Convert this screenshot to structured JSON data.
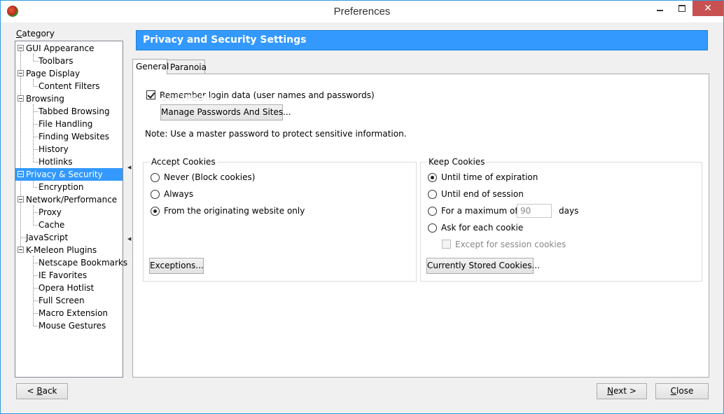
{
  "window": {
    "title": "Preferences",
    "minimize_symbol": "—",
    "maximize_symbol": "□",
    "close_symbol": "✕"
  },
  "sidebar": {
    "label": "Category",
    "items": [
      {
        "label": "GUI Appearance",
        "level": 0
      },
      {
        "label": "Toolbars",
        "level": 1
      },
      {
        "label": "Page Display",
        "level": 0
      },
      {
        "label": "Content Filters",
        "level": 1
      },
      {
        "label": "Browsing",
        "level": 0
      },
      {
        "label": "Tabbed Browsing",
        "level": 1
      },
      {
        "label": "File Handling",
        "level": 1
      },
      {
        "label": "Finding Websites",
        "level": 1
      },
      {
        "label": "History",
        "level": 1
      },
      {
        "label": "Hotlinks",
        "level": 1
      },
      {
        "label": "Privacy & Security",
        "level": 0,
        "selected": true
      },
      {
        "label": "Encryption",
        "level": 1
      },
      {
        "label": "Network/Performance",
        "level": 0
      },
      {
        "label": "Proxy",
        "level": 1
      },
      {
        "label": "Cache",
        "level": 1
      },
      {
        "label": "JavaScript",
        "level": 0
      },
      {
        "label": "K-Meleon Plugins",
        "level": 0
      },
      {
        "label": "Netscape Bookmarks",
        "level": 1
      },
      {
        "label": "IE Favorites",
        "level": 1
      },
      {
        "label": "Opera Hotlist",
        "level": 1
      },
      {
        "label": "Full Screen",
        "level": 1
      },
      {
        "label": "Macro Extension",
        "level": 1
      },
      {
        "label": "Mouse Gestures",
        "level": 1
      }
    ]
  },
  "main": {
    "header": "Privacy and Security Settings",
    "tabs": [
      {
        "label": "General",
        "active": true
      },
      {
        "label": "Paranoia",
        "active": false
      }
    ],
    "watermark": "SOFTPEDIA",
    "remember_login": {
      "label": "Remember login data (user names and passwords)",
      "checked": true
    },
    "manage_passwords_label": "Manage Passwords And Sites...",
    "note": "Note: Use a master password to protect sensitive information.",
    "accept_cookies": {
      "title": "Accept Cookies",
      "options": [
        {
          "label": "Never (Block cookies)",
          "selected": false
        },
        {
          "label": "Always",
          "selected": false
        },
        {
          "label": "From the originating website only",
          "selected": true
        }
      ],
      "exceptions_label": "Exceptions..."
    },
    "keep_cookies": {
      "title": "Keep Cookies",
      "options": [
        {
          "label": "Until time of expiration",
          "selected": true
        },
        {
          "label": "Until end of session",
          "selected": false
        },
        {
          "label": "For a maximum of",
          "selected": false
        },
        {
          "label": "Ask for each cookie",
          "selected": false
        }
      ],
      "max_days_value": "90",
      "days_label": "days",
      "except_session": {
        "label": "Except for session cookies",
        "checked": false,
        "disabled": true
      },
      "stored_cookies_label": "Currently Stored Cookies..."
    }
  },
  "footer": {
    "back": {
      "prefix": "< ",
      "mnemonic": "B",
      "rest": "ack"
    },
    "next": {
      "mnemonic": "N",
      "rest": "ext >"
    },
    "close": {
      "mnemonic": "C",
      "rest": "lose"
    }
  }
}
